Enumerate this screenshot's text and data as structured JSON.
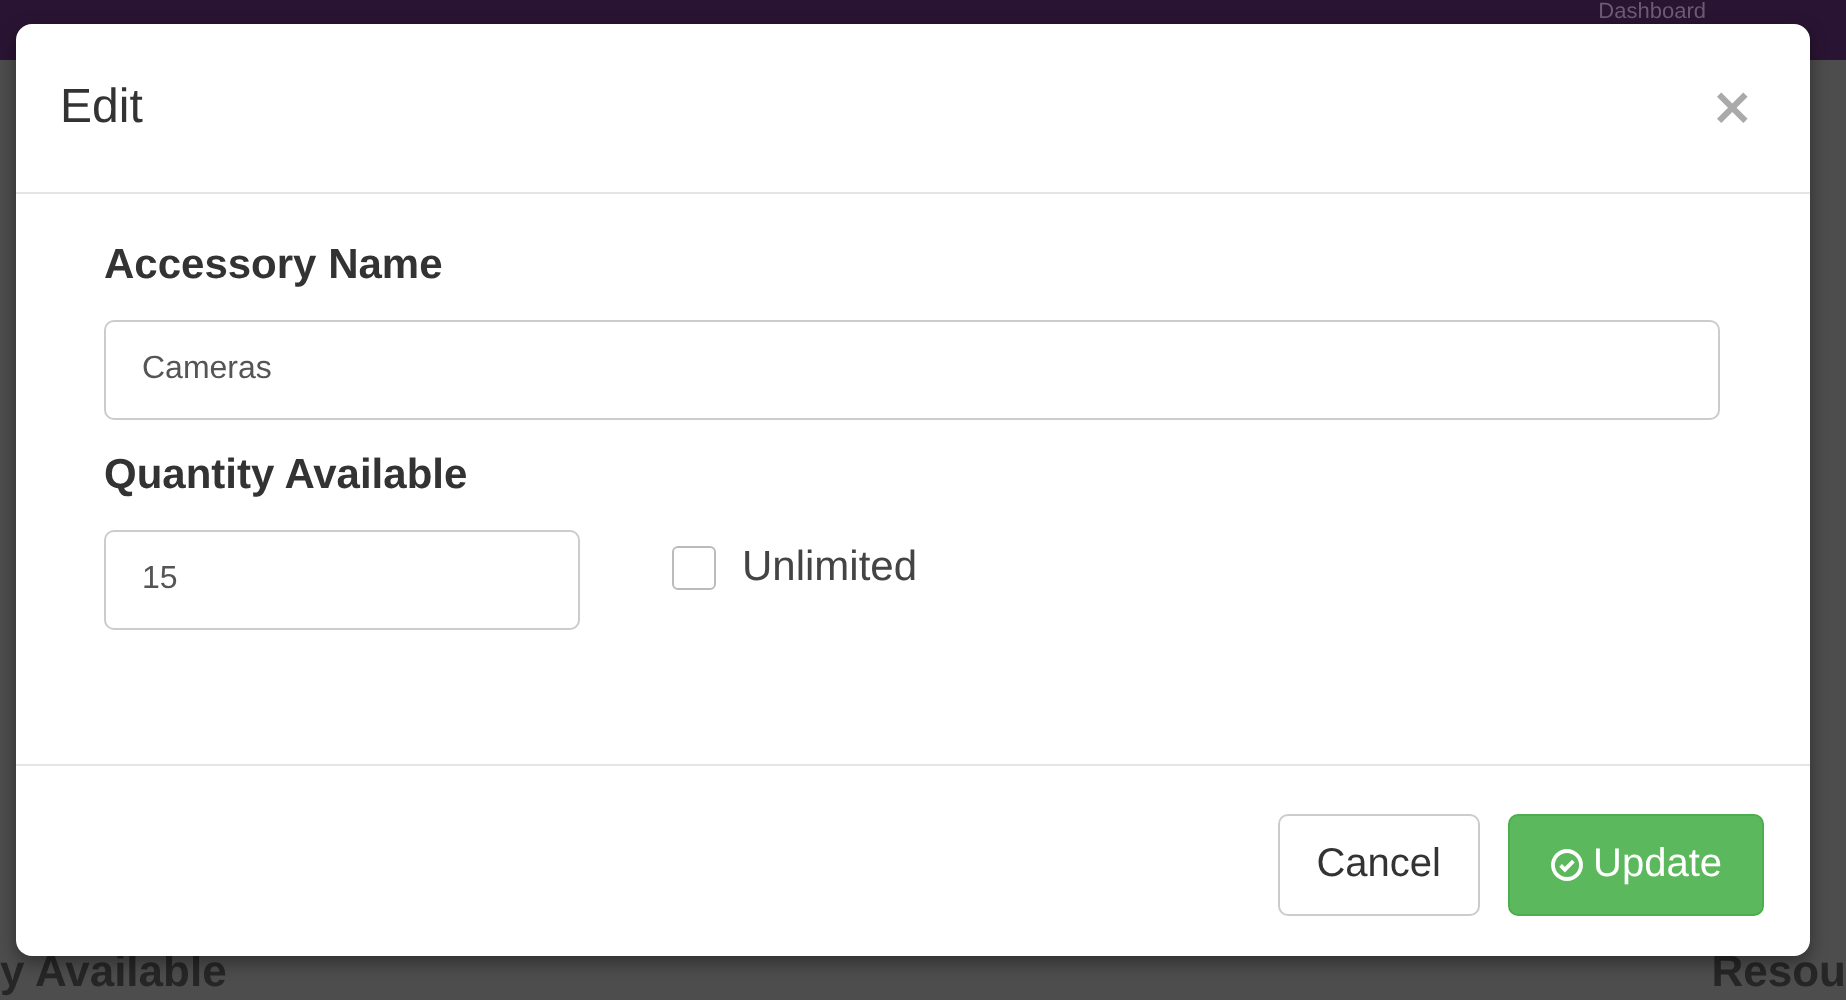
{
  "background": {
    "nav_link": "Dashboard",
    "heading_left": "y Available",
    "heading_right": "Resou"
  },
  "dialog": {
    "title": "Edit",
    "close": "×",
    "fields": [
      {
        "label": "Accessory Name",
        "value": "Cameras",
        "kind": "wide"
      },
      {
        "label": "Quantity Available",
        "value": "15",
        "kind": "narrow",
        "checkbox": {
          "label": "Unlimited",
          "checked": false
        }
      }
    ],
    "buttons": [
      {
        "label": "Cancel",
        "kind": "default"
      },
      {
        "label": "Update",
        "kind": "primary"
      }
    ]
  }
}
